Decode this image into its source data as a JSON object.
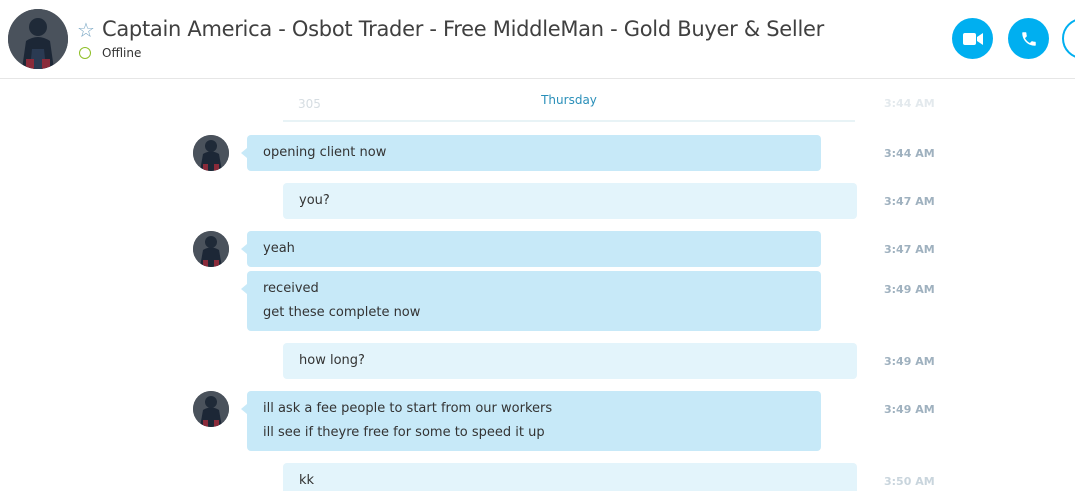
{
  "header": {
    "title": "Captain America - Osbot Trader - Free MiddleMan - Gold Buyer & Seller",
    "status": "Offline",
    "colors": {
      "accent": "#00aff0",
      "status_offline": "#8fbf28"
    }
  },
  "chat": {
    "day_label": "Thursday",
    "faded_top_text": "305",
    "faded_top_time": "3:44 AM",
    "messages": [
      {
        "direction": "in",
        "lines": [
          "opening client now"
        ],
        "time": "3:44 AM"
      },
      {
        "direction": "out",
        "lines": [
          "you?"
        ],
        "time": "3:47 AM"
      },
      {
        "direction": "in",
        "lines": [
          "yeah"
        ],
        "time": "3:47 AM"
      },
      {
        "direction": "in",
        "lines": [
          "received",
          "get these complete now"
        ],
        "time": "3:49 AM"
      },
      {
        "direction": "out",
        "lines": [
          "how long?"
        ],
        "time": "3:49 AM"
      },
      {
        "direction": "in",
        "lines": [
          "ill ask a fee people to start from our workers",
          "ill see if theyre free for some to speed it up"
        ],
        "time": "3:49 AM"
      },
      {
        "direction": "out",
        "lines": [
          "kk"
        ],
        "time": "3:50 AM"
      }
    ]
  },
  "icons": {
    "favorite": "star-outline-icon",
    "video_call": "video-camera-icon",
    "audio_call": "phone-icon",
    "add_people": "add-people-icon"
  }
}
